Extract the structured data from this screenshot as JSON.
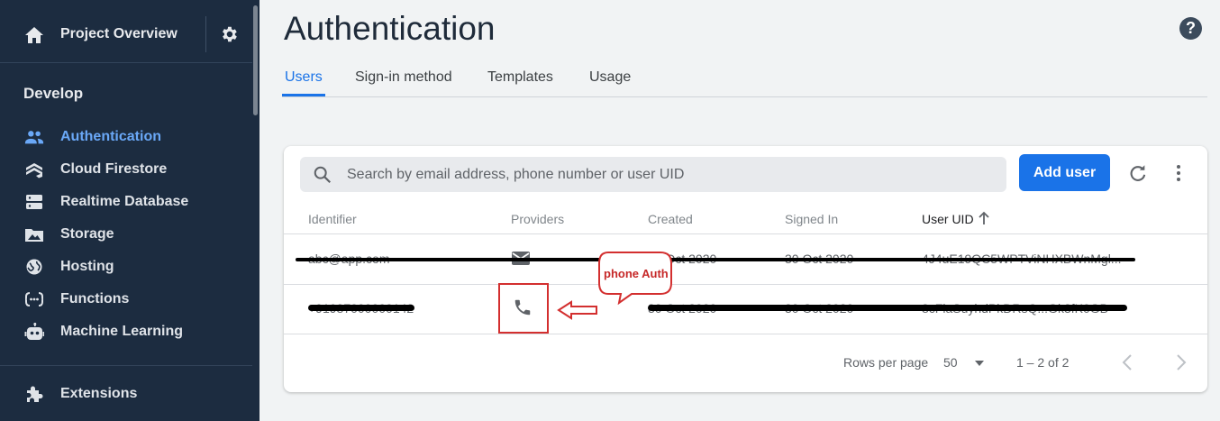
{
  "sidebar": {
    "project_overview": "Project Overview",
    "section_label": "Develop",
    "items": [
      {
        "label": "Authentication",
        "icon": "people-icon",
        "active": true
      },
      {
        "label": "Cloud Firestore",
        "icon": "firestore-icon"
      },
      {
        "label": "Realtime Database",
        "icon": "database-icon"
      },
      {
        "label": "Storage",
        "icon": "folder-image-icon"
      },
      {
        "label": "Hosting",
        "icon": "globe-icon"
      },
      {
        "label": "Functions",
        "icon": "functions-icon"
      },
      {
        "label": "Machine Learning",
        "icon": "robot-icon"
      }
    ],
    "extensions": "Extensions"
  },
  "header": {
    "title": "Authentication",
    "help_icon": "?"
  },
  "tabs": [
    {
      "label": "Users",
      "active": true
    },
    {
      "label": "Sign-in method"
    },
    {
      "label": "Templates"
    },
    {
      "label": "Usage"
    }
  ],
  "toolbar": {
    "search_placeholder": "Search by email address, phone number or user UID",
    "add_user": "Add user"
  },
  "table": {
    "columns": [
      "Identifier",
      "Providers",
      "Created",
      "Signed In",
      "User UID"
    ],
    "sorted_column": "User UID",
    "rows": [
      {
        "identifier": "abc@app.com",
        "provider": "email-icon",
        "created": "30 Oct 2020",
        "signed_in": "30 Oct 2020",
        "uid": "4J4uE19QC5WPTViNHXBWnMgl..."
      },
      {
        "identifier": "+91987000000142",
        "provider": "phone-icon",
        "created": "30 Oct 2020",
        "signed_in": "30 Oct 2020",
        "uid": "8cFlaSuyhdPkDRsQ...Gk3fK0GB"
      }
    ]
  },
  "annotation": {
    "bubble_text": "phone Auth",
    "color": "#d32f2f"
  },
  "pagination": {
    "rows_per_page_label": "Rows per page",
    "rows_per_page": "50",
    "range": "1 – 2 of 2"
  },
  "colors": {
    "sidebar_bg": "#1c2c40",
    "accent": "#1a73e8",
    "active_nav": "#6aa8f7"
  }
}
